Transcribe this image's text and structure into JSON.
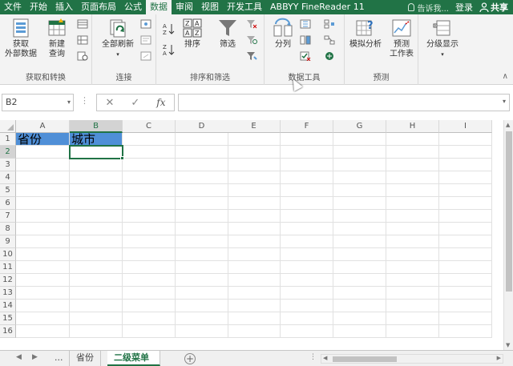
{
  "tabs": [
    {
      "label": "文件",
      "active": false
    },
    {
      "label": "开始",
      "active": false
    },
    {
      "label": "插入",
      "active": false
    },
    {
      "label": "页面布局",
      "active": false
    },
    {
      "label": "公式",
      "active": false
    },
    {
      "label": "数据",
      "active": true
    },
    {
      "label": "审阅",
      "active": false
    },
    {
      "label": "视图",
      "active": false
    },
    {
      "label": "开发工具",
      "active": false
    },
    {
      "label": "ABBYY FineReader 11",
      "active": false
    }
  ],
  "topright": {
    "tell_me": "告诉我...",
    "login": "登录",
    "share": "共享"
  },
  "ribbon": {
    "get_external_line1": "获取",
    "get_external_line2": "外部数据",
    "new_query_line1": "新建",
    "new_query_line2": "查询",
    "group1_label": "获取和转换",
    "refresh_all": "全部刷新",
    "group2_label": "连接",
    "sort": "排序",
    "filter": "筛选",
    "group3_label": "排序和筛选",
    "text_to_columns": "分列",
    "group4_label": "数据工具",
    "what_if": "模拟分析",
    "forecast_line1": "预测",
    "forecast_line2": "工作表",
    "group5_label": "预测",
    "outline": "分级显示"
  },
  "formula_bar": {
    "name_box": "B2",
    "fx": "fx",
    "cancel": "✕",
    "enter": "✓",
    "value": ""
  },
  "columns": [
    "A",
    "B",
    "C",
    "D",
    "E",
    "F",
    "G",
    "H",
    "I"
  ],
  "rows": [
    "1",
    "2",
    "3",
    "4",
    "5",
    "6",
    "7",
    "8",
    "9",
    "10",
    "11",
    "12",
    "13",
    "14",
    "15",
    "16"
  ],
  "cells": {
    "A1": "省份",
    "B1": "城市"
  },
  "sheets": {
    "ellipsis": "...",
    "tabs": [
      "省份",
      "二级菜单"
    ],
    "active": "二级菜单"
  },
  "colors": {
    "accent": "#217346",
    "header_fill": "#4f8fd7"
  }
}
